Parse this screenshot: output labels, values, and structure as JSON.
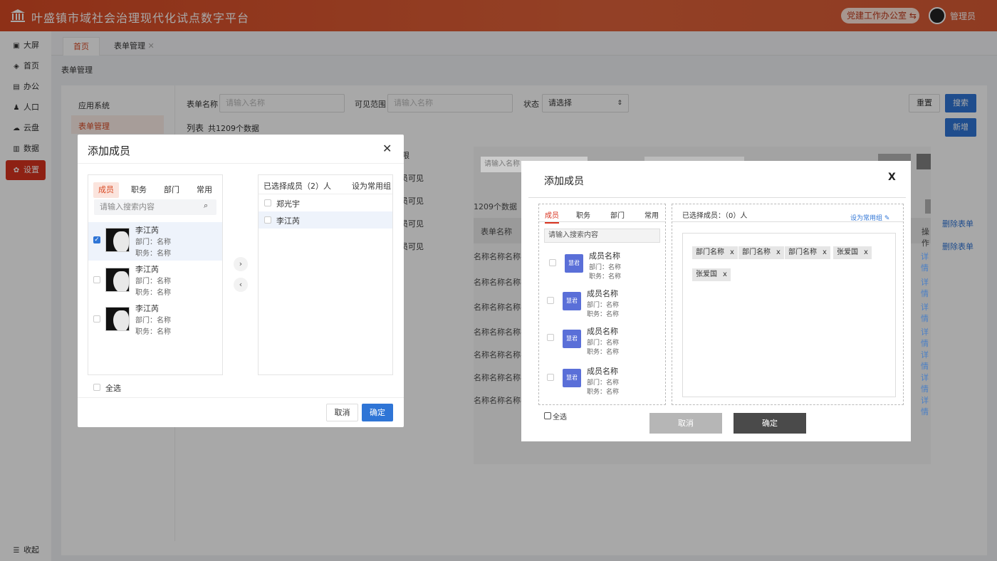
{
  "header": {
    "title": "叶盛镇市域社会治理现代化试点数字平台",
    "office_label": "党建工作办公室 ⇆",
    "user_name": "管理员"
  },
  "sidebar": {
    "items": [
      {
        "icon": "▣",
        "label": "大屏"
      },
      {
        "icon": "◈",
        "label": "首页"
      },
      {
        "icon": "▤",
        "label": "办公"
      },
      {
        "icon": "♟",
        "label": "人口"
      },
      {
        "icon": "☁",
        "label": "云盘"
      },
      {
        "icon": "▥",
        "label": "数据"
      },
      {
        "icon": "✿",
        "label": "设置"
      }
    ],
    "collapse_label": "收起"
  },
  "tabs": [
    {
      "label": "首页"
    },
    {
      "label": "表单管理",
      "close": "✕"
    }
  ],
  "breadcrumb": "表单管理",
  "left_menu": {
    "items": [
      "应用系统",
      "表单管理"
    ]
  },
  "filters": {
    "form_name_label": "表单名称",
    "form_name_placeholder": "请输入名称",
    "scope_label": "可见范围",
    "scope_placeholder": "请输入名称",
    "status_label": "状态",
    "status_value": "请选择",
    "reset": "重置",
    "search": "搜索",
    "add": "新增"
  },
  "list": {
    "title": "列表",
    "count_text": "共1209个数据",
    "col_scope": "限",
    "scope_rows": [
      "员可见",
      "员可见",
      "员可见",
      "员可见"
    ],
    "actions": [
      "删除表单",
      "删除表单"
    ]
  },
  "bg_frame": {
    "search_placeholder": "请输入名称",
    "count_text": "1209个数据",
    "col_form_name": "表单名称",
    "col_ops": "操作",
    "row_text": "名称名称名称名称",
    "detail": "详情"
  },
  "modal1": {
    "title": "添加成员",
    "close": "✕",
    "tabs": [
      "成员",
      "职务",
      "部门",
      "常用"
    ],
    "search_placeholder": "请输入搜索内容",
    "members": [
      {
        "name": "李江芮",
        "dept": "部门：名称",
        "role": "职务：名称",
        "checked": true
      },
      {
        "name": "李江芮",
        "dept": "部门：名称",
        "role": "职务：名称",
        "checked": false
      },
      {
        "name": "李江芮",
        "dept": "部门：名称",
        "role": "职务：名称",
        "checked": false
      }
    ],
    "move_right": "›",
    "move_left": "‹",
    "selected_title": "已选择成员（2）人",
    "set_group": "设为常用组",
    "selected": [
      "郑光宇",
      "李江芮"
    ],
    "select_all": "全选",
    "cancel": "取消",
    "confirm": "确定"
  },
  "modal2": {
    "title": "添加成员",
    "close": "X",
    "tabs": [
      "成员",
      "职务",
      "部门",
      "常用"
    ],
    "search_placeholder": "请输入搜索内容",
    "members": [
      {
        "badge": "慧君",
        "name": "成员名称",
        "dept": "部门：名称",
        "role": "职务：名称"
      },
      {
        "badge": "慧君",
        "name": "成员名称",
        "dept": "部门：名称",
        "role": "职务：名称"
      },
      {
        "badge": "慧君",
        "name": "成员名称",
        "dept": "部门：名称",
        "role": "职务：名称"
      },
      {
        "badge": "慧君",
        "name": "成员名称",
        "dept": "部门：名称",
        "role": "职务：名称"
      }
    ],
    "selected_title": "已选择成员：（0）人",
    "set_group": "设为常用组",
    "tags": [
      "部门名称",
      "部门名称",
      "部门名称",
      "张爱国",
      "张爱国"
    ],
    "tag_close": "x",
    "select_all": "全选",
    "cancel": "取消",
    "confirm": "确定"
  }
}
